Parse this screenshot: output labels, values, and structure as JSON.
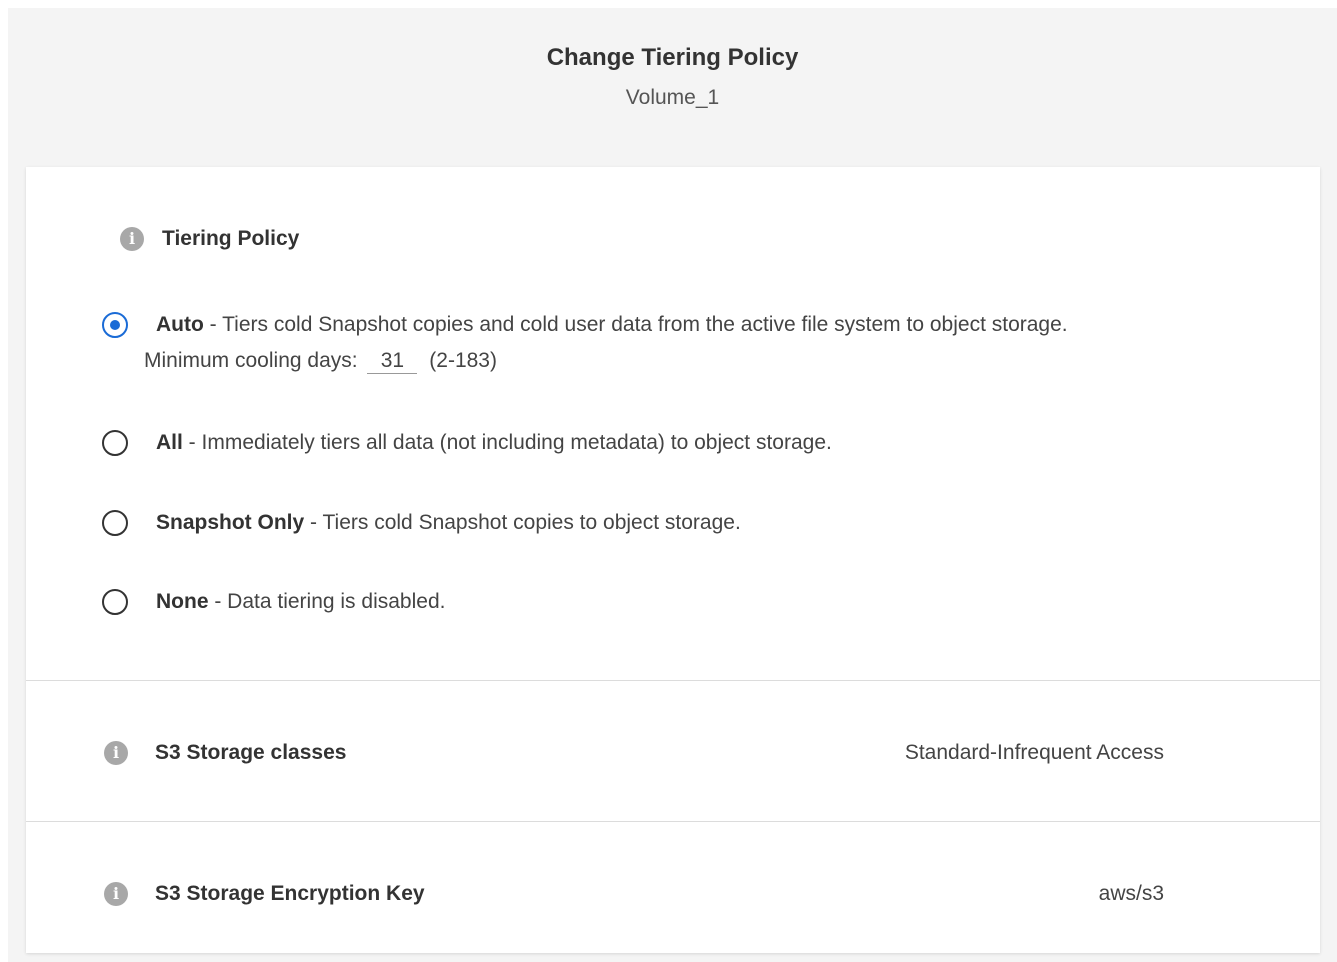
{
  "dialog": {
    "title": "Change Tiering Policy",
    "subtitle": "Volume_1"
  },
  "tiering_policy": {
    "label": "Tiering Policy",
    "selected": "auto",
    "options": [
      {
        "id": "auto",
        "name": "Auto",
        "separator": " - ",
        "description": "Tiers cold Snapshot copies and cold user data from the active file system to object storage.",
        "checked": true
      },
      {
        "id": "all",
        "name": "All",
        "separator": " - ",
        "description": "Immediately tiers all data (not including metadata) to object storage.",
        "checked": false
      },
      {
        "id": "snapshot-only",
        "name": "Snapshot Only",
        "separator": " - ",
        "description": "Tiers cold Snapshot copies to object storage.",
        "checked": false
      },
      {
        "id": "none",
        "name": "None",
        "separator": " - ",
        "description": "Data tiering is disabled.",
        "checked": false
      }
    ],
    "cooling": {
      "label": "Minimum cooling days:",
      "value": "31",
      "range": "(2-183)"
    }
  },
  "storage_class": {
    "label": "S3 Storage classes",
    "value": "Standard-Infrequent Access"
  },
  "encryption_key": {
    "label": "S3 Storage Encryption Key",
    "value": "aws/s3"
  },
  "colors": {
    "accent": "#1a6bd6",
    "background": "#f4f4f4",
    "info_icon": "#a8a8a8",
    "divider": "#dcdcdc"
  },
  "icons": {
    "info": "info-icon"
  }
}
